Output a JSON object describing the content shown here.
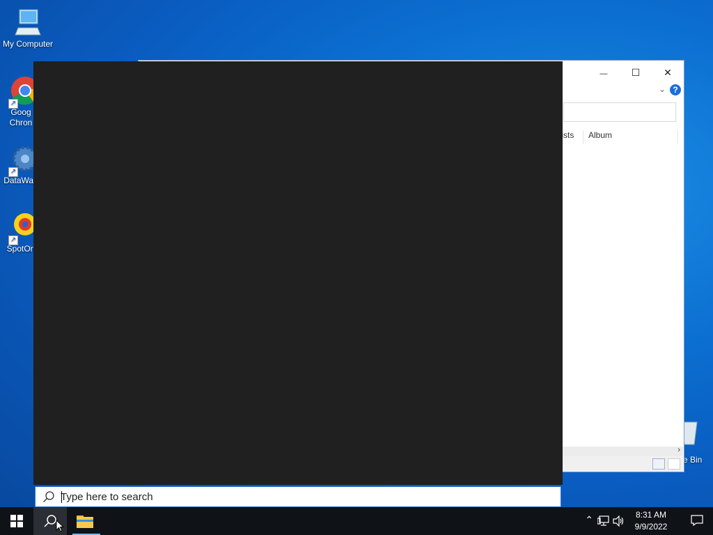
{
  "desktop": {
    "icons": [
      {
        "label": "My Computer"
      },
      {
        "label": "Goog\nChron"
      },
      {
        "label": "DataWag"
      },
      {
        "label": "SpotOn"
      },
      {
        "label": "e Bin"
      }
    ]
  },
  "background_window": {
    "columns": [
      "tists",
      "Album"
    ],
    "controls": {
      "minimize": "—",
      "maximize": "☐",
      "close": "✕"
    },
    "help_icon": "?"
  },
  "search_panel": {
    "placeholder": "Type here to search"
  },
  "taskbar": {
    "time": "8:31 AM",
    "date": "9/9/2022"
  },
  "colors": {
    "panel_bg": "#202020",
    "taskbar_bg": "#0f1216",
    "accent": "#2a72d6"
  }
}
